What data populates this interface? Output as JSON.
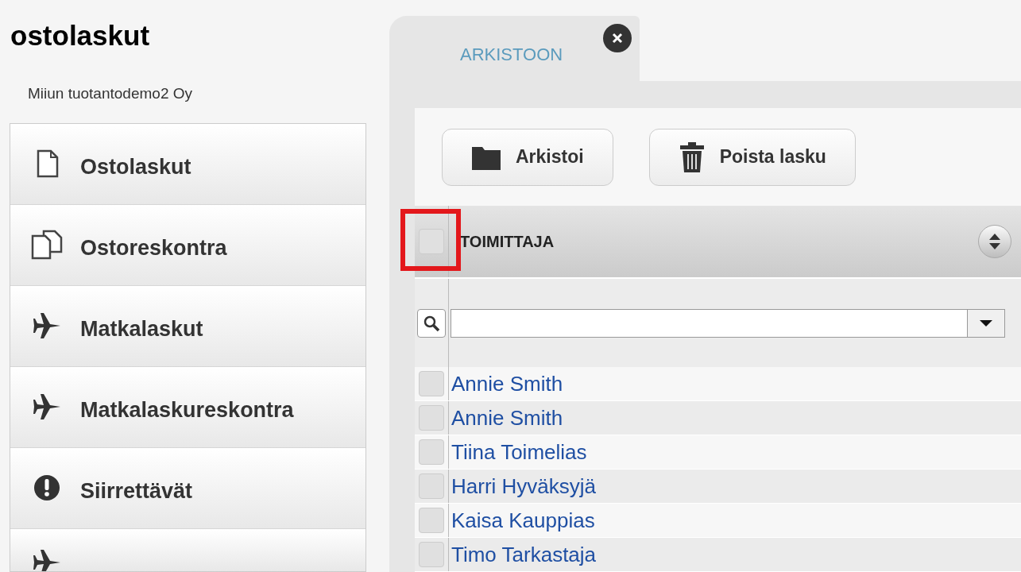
{
  "app_title": "ostolaskut",
  "company": "Miiun tuotantodemo2 Oy",
  "sidebar": {
    "items": [
      {
        "label": "Ostolaskut",
        "kind": "page"
      },
      {
        "label": "Ostoreskontra",
        "kind": "pages"
      },
      {
        "label": "Matkalaskut",
        "kind": "plane"
      },
      {
        "label": "Matkalaskureskontra",
        "kind": "plane"
      },
      {
        "label": "Siirrettävät",
        "kind": "alert"
      },
      {
        "kind": "plane"
      }
    ]
  },
  "tabs": [
    {
      "label": "ARKISTOON",
      "selected": true
    }
  ],
  "toolbar": [
    {
      "label": "Arkistoi",
      "kind": "folder"
    },
    {
      "label": "Poista lasku",
      "kind": "trash"
    }
  ],
  "table": {
    "select_all": {
      "checked": false,
      "highlighted": true
    },
    "columns": [
      {
        "label": "TOIMITTAJA"
      }
    ],
    "rows": [
      {
        "supplier": "Annie Smith",
        "checked": false
      },
      {
        "supplier": "Annie Smith",
        "checked": false
      },
      {
        "supplier": "Tiina Toimelias",
        "checked": false
      },
      {
        "supplier": "Harri Hyväksyjä",
        "checked": false
      },
      {
        "supplier": "Kaisa Kauppias",
        "checked": false
      },
      {
        "supplier": "Timo Tarkastaja",
        "checked": false
      }
    ]
  }
}
